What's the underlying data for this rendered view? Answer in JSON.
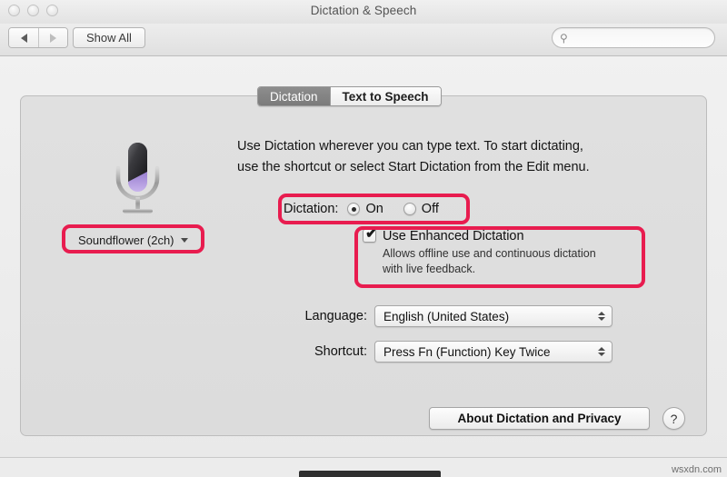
{
  "window": {
    "title": "Dictation & Speech",
    "traffic_lights": [
      "close",
      "minimize",
      "zoom"
    ]
  },
  "toolbar": {
    "back_label": "back-arrow",
    "forward_label": "forward-arrow",
    "show_all_label": "Show All",
    "search": {
      "placeholder": "",
      "value": "",
      "icon": "search-icon"
    }
  },
  "tabs": [
    {
      "label": "Dictation",
      "selected": true
    },
    {
      "label": "Text to Speech",
      "selected": false
    }
  ],
  "main": {
    "description_line1": "Use Dictation wherever you can type text. To start dictating,",
    "description_line2": "use the shortcut or select Start Dictation from the Edit menu.",
    "mic_icon": "microphone-icon",
    "source_popup": {
      "value": "Soundflower (2ch)",
      "icon": "caret-down-icon"
    },
    "dictation": {
      "label": "Dictation:",
      "options": [
        {
          "label": "On",
          "selected": true
        },
        {
          "label": "Off",
          "selected": false
        }
      ]
    },
    "enhanced": {
      "label": "Use Enhanced Dictation",
      "checked": true,
      "checkmark": "✔",
      "sub_line1": "Allows offline use and continuous dictation",
      "sub_line2": "with live feedback."
    },
    "language": {
      "label": "Language:",
      "value": "English (United States)"
    },
    "shortcut": {
      "label": "Shortcut:",
      "value": "Press Fn (Function) Key Twice"
    },
    "about_button": "About Dictation and Privacy",
    "help_button": "?"
  },
  "annotations": {
    "color": "#e81c4f",
    "boxes": [
      "source-popup",
      "dictation-radio-row",
      "enhanced-dictation-block"
    ]
  },
  "watermark": "wsxdn.com"
}
